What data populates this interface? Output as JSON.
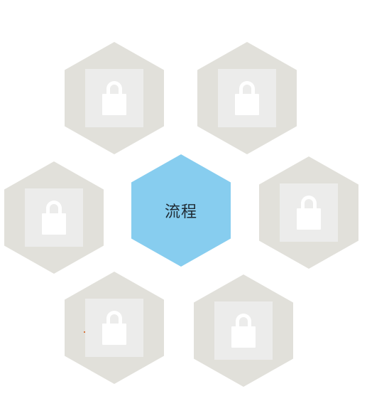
{
  "center": {
    "label": "流程",
    "color": "#87cdef"
  },
  "locked_tiles": [
    {
      "name": "locked-tile-top-left",
      "icon": "lock-icon"
    },
    {
      "name": "locked-tile-top-right",
      "icon": "lock-icon"
    },
    {
      "name": "locked-tile-middle-left",
      "icon": "lock-icon"
    },
    {
      "name": "locked-tile-middle-right",
      "icon": "lock-icon"
    },
    {
      "name": "locked-tile-bottom-left",
      "icon": "lock-icon"
    },
    {
      "name": "locked-tile-bottom-right",
      "icon": "lock-icon"
    }
  ],
  "colors": {
    "locked_tile": "#e1e0da",
    "lock_box": "#ececeb",
    "lock_glyph": "#ffffff"
  }
}
